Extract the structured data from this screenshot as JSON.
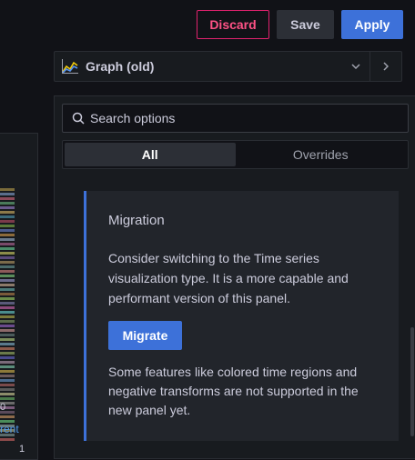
{
  "toolbar": {
    "discard_label": "Discard",
    "save_label": "Save",
    "apply_label": "Apply"
  },
  "viz_picker": {
    "selected": "Graph (old)",
    "icon": "graph-icon",
    "chevron_icon": "chevron-down-icon",
    "next_icon": "chevron-right-icon"
  },
  "options": {
    "search_placeholder": "Search options",
    "tabs": [
      {
        "label": "All",
        "active": true
      },
      {
        "label": "Overrides",
        "active": false
      }
    ]
  },
  "migration": {
    "title": "Migration",
    "body": "Consider switching to the Time series visualization type. It is a more capable and performant version of this panel.",
    "button_label": "Migrate",
    "note": "Some features like colored time regions and negative transforms are not supported in the new panel yet."
  },
  "left_panel": {
    "axis_zero": "0",
    "legend_fragment": "rent",
    "value_fragment": "1"
  },
  "colors": {
    "accent": "#3d71d9",
    "danger": "#e0226e",
    "background": "#111217",
    "panel": "#181b1f"
  }
}
